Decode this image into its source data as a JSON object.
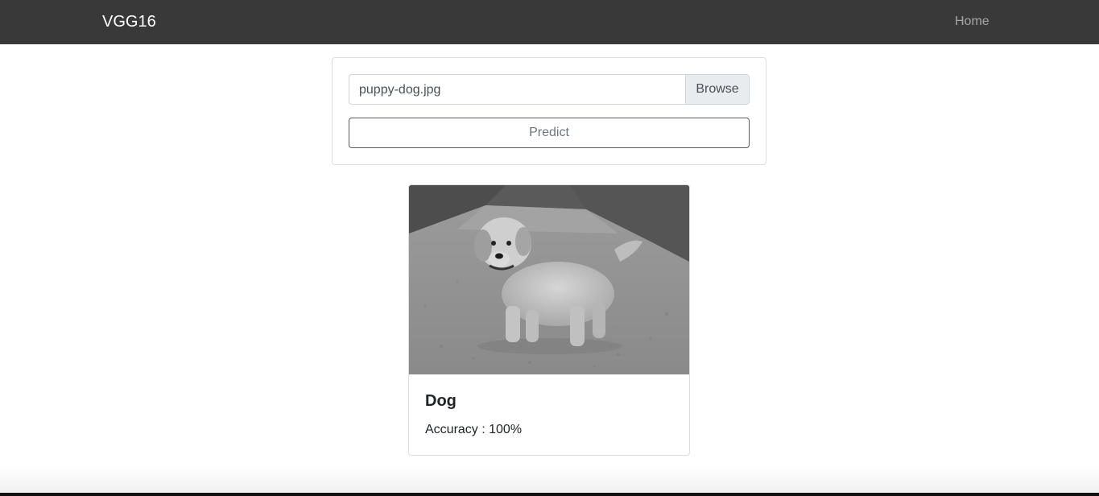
{
  "navbar": {
    "brand": "VGG16",
    "links": [
      {
        "label": "Home"
      }
    ]
  },
  "upload": {
    "file_name": "puppy-dog.jpg",
    "browse_label": "Browse",
    "predict_label": "Predict"
  },
  "result": {
    "image_subject": "golden retriever puppy on gravel road (grayscale)",
    "title": "Dog",
    "accuracy_text": "Accuracy : 100%"
  },
  "colors": {
    "navbar_bg": "#393939",
    "navbar_brand": "#ffffff",
    "navbar_link": "#a6a6a6",
    "border": "#dcdfe2",
    "browse_bg": "#e9ecef"
  }
}
